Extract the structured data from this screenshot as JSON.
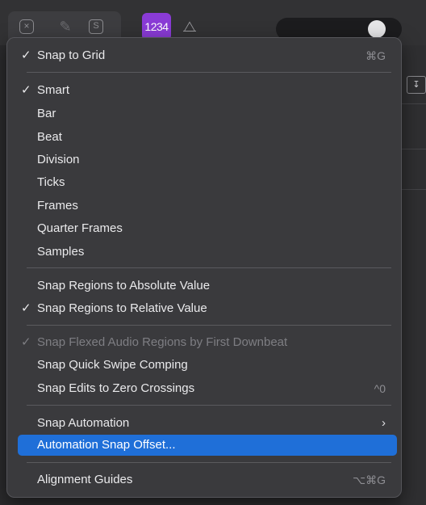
{
  "toolbar": {
    "count_in_label": "1234",
    "tool_icons": [
      "close-box-icon",
      "pencil-icon",
      "solo-icon",
      "metronome-icon"
    ]
  },
  "right_panel": {
    "button_glyph": "↧"
  },
  "menu": {
    "snap_to_grid": {
      "label": "Snap to Grid",
      "checked": true,
      "shortcut": "⌘G"
    },
    "snap_modes": [
      {
        "label": "Smart",
        "checked": true
      },
      {
        "label": "Bar",
        "checked": false
      },
      {
        "label": "Beat",
        "checked": false
      },
      {
        "label": "Division",
        "checked": false
      },
      {
        "label": "Ticks",
        "checked": false
      },
      {
        "label": "Frames",
        "checked": false
      },
      {
        "label": "Quarter Frames",
        "checked": false
      },
      {
        "label": "Samples",
        "checked": false
      }
    ],
    "region_snap": [
      {
        "label": "Snap Regions to Absolute Value",
        "checked": false
      },
      {
        "label": "Snap Regions to Relative Value",
        "checked": true
      }
    ],
    "misc": [
      {
        "label": "Snap Flexed Audio Regions by First Downbeat",
        "checked": true,
        "disabled": true
      },
      {
        "label": "Snap Quick Swipe Comping",
        "checked": false
      },
      {
        "label": "Snap Edits to Zero Crossings",
        "checked": false,
        "shortcut": "^0"
      }
    ],
    "automation": {
      "snap_automation": {
        "label": "Snap Automation",
        "submenu": "›"
      },
      "automation_snap_offset": {
        "label": "Automation Snap Offset...",
        "highlighted": true
      }
    },
    "alignment_guides": {
      "label": "Alignment Guides",
      "shortcut": "⌥⌘G"
    },
    "check_glyph": "✓"
  },
  "colors": {
    "accent_highlight": "#1f6fd8",
    "count_in_purple": "#8a3bd6",
    "menu_bg": "#3a3a3d"
  }
}
